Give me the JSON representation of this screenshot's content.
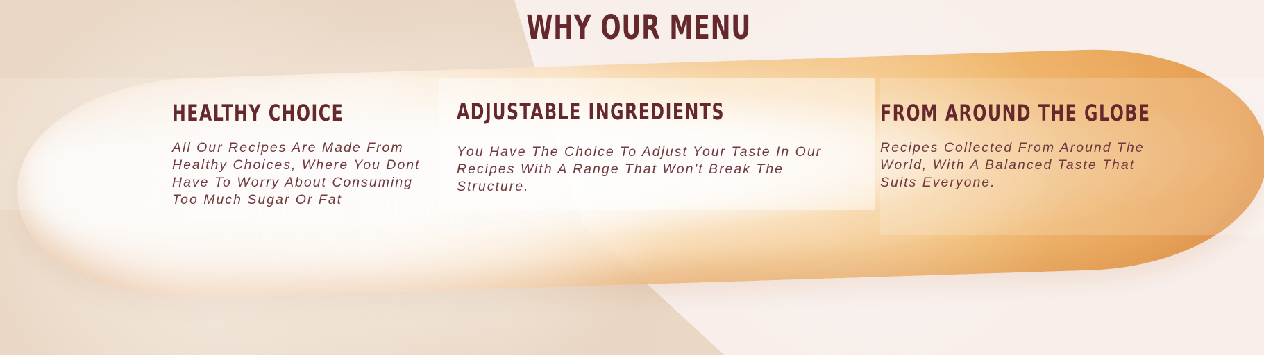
{
  "section": {
    "title": "WHY OUR MENU",
    "cards": [
      {
        "title": "HEALTHY CHOICE",
        "description": "All Our Recipes Are Made From Healthy Choices, Where You Dont Have To Worry About Consuming Too Much Sugar Or Fat"
      },
      {
        "title": "ADJUSTABLE INGREDIENTS",
        "description": "You Have The Choice To Adjust Your Taste In Our Recipes With A Range That Won't Break The Structure."
      },
      {
        "title": "FROM AROUND THE GLOBE",
        "description": "Recipes Collected From Around The World, With A Balanced Taste That Suits Everyone."
      }
    ]
  },
  "colors": {
    "heading": "#64282d",
    "body_text": "#6f3a3d",
    "card_overlay": "#ffffff",
    "bread": "#f2b765"
  }
}
